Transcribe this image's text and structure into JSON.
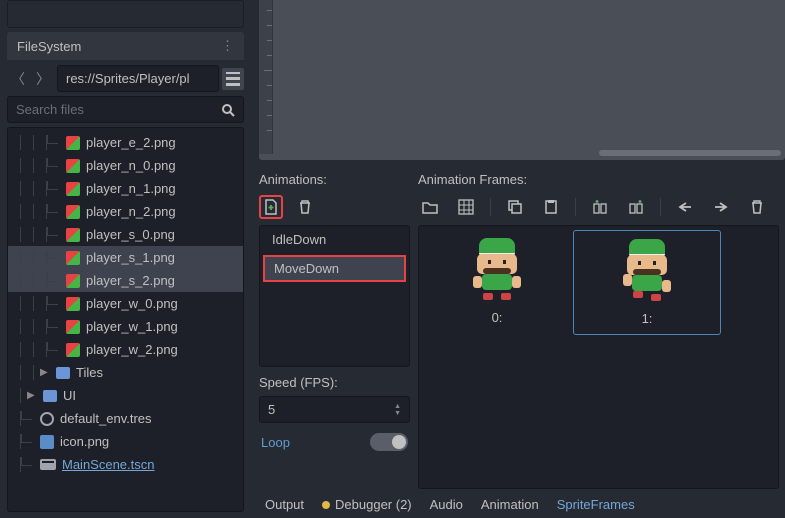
{
  "filesystem": {
    "title": "FileSystem",
    "path": "res://Sprites/Player/pl",
    "search_placeholder": "Search files",
    "files": [
      {
        "name": "player_e_2.png",
        "type": "img"
      },
      {
        "name": "player_n_0.png",
        "type": "img"
      },
      {
        "name": "player_n_1.png",
        "type": "img"
      },
      {
        "name": "player_n_2.png",
        "type": "img"
      },
      {
        "name": "player_s_0.png",
        "type": "img"
      },
      {
        "name": "player_s_1.png",
        "type": "img",
        "selected": true
      },
      {
        "name": "player_s_2.png",
        "type": "img",
        "selected": true
      },
      {
        "name": "player_w_0.png",
        "type": "img"
      },
      {
        "name": "player_w_1.png",
        "type": "img"
      },
      {
        "name": "player_w_2.png",
        "type": "img"
      }
    ],
    "folders": [
      {
        "name": "Tiles"
      },
      {
        "name": "UI"
      }
    ],
    "resources": [
      {
        "name": "default_env.tres",
        "icon": "res"
      },
      {
        "name": "icon.png",
        "icon": "imgblue"
      },
      {
        "name": "MainScene.tscn",
        "icon": "scene",
        "link": true
      }
    ]
  },
  "spriteframes": {
    "animations_label": "Animations:",
    "frames_label": "Animation Frames:",
    "animations": [
      {
        "name": "IdleDown"
      },
      {
        "name": "MoveDown",
        "editing": true
      }
    ],
    "speed_label": "Speed (FPS):",
    "speed_value": "5",
    "loop_label": "Loop",
    "frames": [
      {
        "label": "0:"
      },
      {
        "label": "1:",
        "selected": true
      }
    ]
  },
  "bottom_tabs": {
    "output": "Output",
    "debugger": "Debugger (2)",
    "audio": "Audio",
    "animation": "Animation",
    "spriteframes": "SpriteFrames"
  }
}
